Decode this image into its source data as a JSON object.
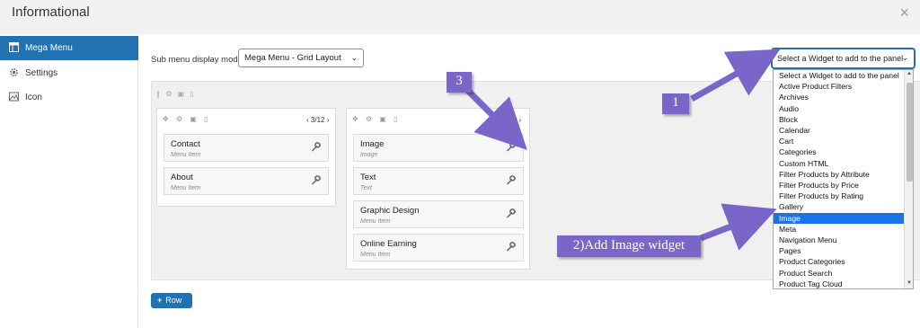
{
  "dialog": {
    "title": "Informational",
    "close_glyph": "×"
  },
  "sidebar": {
    "items": [
      {
        "label": "Mega Menu",
        "icon": "grid-menu-icon",
        "active": true
      },
      {
        "label": "Settings",
        "icon": "gear-icon",
        "active": false
      },
      {
        "label": "Icon",
        "icon": "image-icon",
        "active": false
      }
    ]
  },
  "toolbar": {
    "mode_label": "Sub menu display mode",
    "mode_value": "Mega Menu - Grid Layout",
    "widget_select_value": "Select a Widget to add to the panel"
  },
  "grid": {
    "columns": [
      {
        "size": "3/12",
        "widgets": [
          {
            "title": "Contact",
            "subtitle": "Menu Item"
          },
          {
            "title": "About",
            "subtitle": "Menu Item"
          }
        ]
      },
      {
        "size": "/12",
        "widgets": [
          {
            "title": "Image",
            "subtitle": "Image"
          },
          {
            "title": "Text",
            "subtitle": "Text"
          },
          {
            "title": "Graphic Design",
            "subtitle": "Menu Item"
          },
          {
            "title": "Online Earning",
            "subtitle": "Menu Item"
          }
        ]
      }
    ],
    "add_row_label": "Row"
  },
  "widget_options": [
    "Select a Widget to add to the panel",
    "Active Product Filters",
    "Archives",
    "Audio",
    "Block",
    "Calendar",
    "Cart",
    "Categories",
    "Custom HTML",
    "Filter Products by Attribute",
    "Filter Products by Price",
    "Filter Products by Rating",
    "Gallery",
    "Image",
    "Meta",
    "Navigation Menu",
    "Pages",
    "Product Categories",
    "Product Search",
    "Product Tag Cloud"
  ],
  "highlighted_option": "Image",
  "annotations": {
    "step1": "1",
    "step2": "2)Add Image widget",
    "step3": "3"
  },
  "colors": {
    "accent": "#2271b1",
    "callout": "#7a66c9",
    "selected": "#1a73e8"
  }
}
